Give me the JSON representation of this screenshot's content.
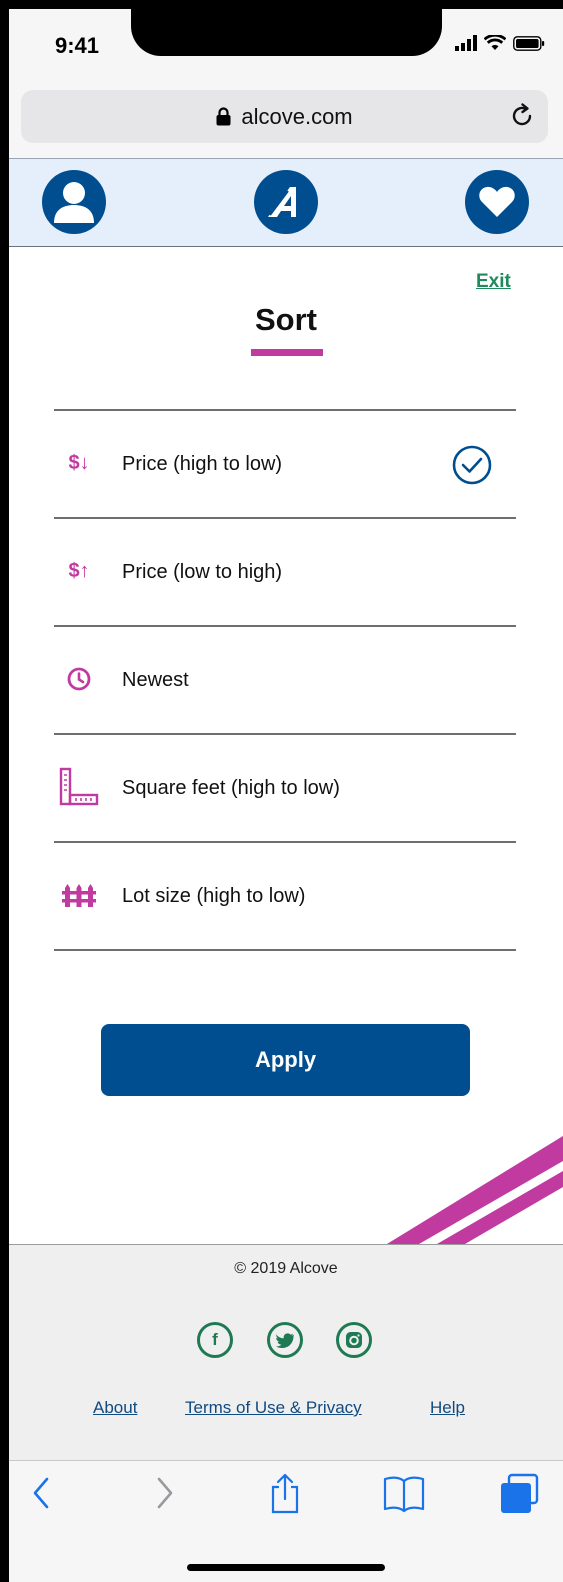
{
  "status_bar": {
    "time": "9:41"
  },
  "browser": {
    "url": "alcove.com"
  },
  "header": {
    "icons": [
      "user-icon",
      "alcove-logo-icon",
      "heart-icon"
    ]
  },
  "sort": {
    "exit_label": "Exit",
    "title": "Sort",
    "options": [
      {
        "icon": "$↓",
        "label": "Price (high to low)",
        "selected": true
      },
      {
        "icon": "$↑",
        "label": "Price (low to high)",
        "selected": false
      },
      {
        "icon": "clock-icon",
        "label": "Newest",
        "selected": false
      },
      {
        "icon": "ruler-icon",
        "label": "Square feet (high to low)",
        "selected": false
      },
      {
        "icon": "fence-icon",
        "label": "Lot size (high to low)",
        "selected": false
      }
    ],
    "apply_label": "Apply"
  },
  "footer": {
    "copyright": "© 2019 Alcove",
    "social": [
      {
        "name": "facebook-icon",
        "glyph": "f"
      },
      {
        "name": "twitter-icon",
        "glyph": ""
      },
      {
        "name": "instagram-icon",
        "glyph": ""
      }
    ],
    "links": [
      "About",
      "Terms of Use & Privacy",
      "Help"
    ]
  },
  "colors": {
    "brand_blue": "#004e8f",
    "accent_magenta": "#c13aa0",
    "link_green": "#1f8a5b",
    "header_bg": "#e4effb",
    "footer_bg": "#efefef",
    "ios_blue": "#1a73e8"
  }
}
